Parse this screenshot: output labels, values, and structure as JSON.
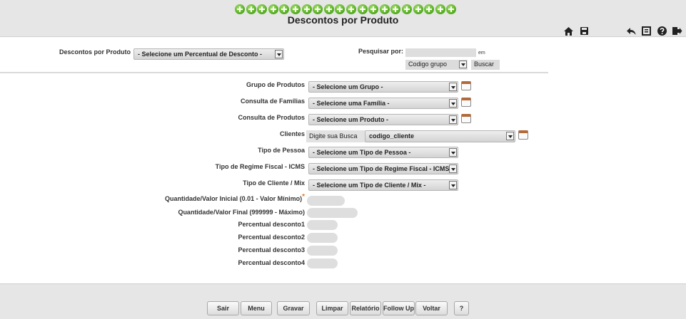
{
  "header": {
    "title": "Descontos por Produto",
    "plus_icon_count": 20,
    "icons": [
      "home-icon",
      "save-icon",
      "back-arrow-icon",
      "report-icon",
      "help-icon",
      "exit-icon"
    ]
  },
  "top_filter": {
    "label": "Descontos por Produto",
    "select_value": "- Selecione um Percentual de Desconto -",
    "search_label": "Pesquisar por:",
    "search_value": "",
    "em_label": "em",
    "search_field": "Codigo grupo",
    "search_button": "Buscar"
  },
  "form": {
    "grupo": {
      "label": "Grupo de Produtos",
      "value": "- Selecione um Grupo -"
    },
    "familias": {
      "label": "Consulta de Famílias",
      "value": "- Selecione uma Família -"
    },
    "produtos": {
      "label": "Consulta de Produtos",
      "value": "- Selecione um Produto -"
    },
    "clientes": {
      "label": "Clientes",
      "search_button": "Digite sua Busca",
      "value": "codigo_cliente"
    },
    "tipo_pessoa": {
      "label": "Tipo de Pessoa",
      "value": "- Selecione um Tipo de Pessoa -"
    },
    "regime": {
      "label": "Tipo de Regime Fiscal - ICMS",
      "value": "- Selecione um Tipo de Regime Fiscal - ICMS -"
    },
    "tipo_cliente": {
      "label": "Tipo de Cliente / Mix",
      "value": "- Selecione um Tipo de Cliente / Mix -"
    },
    "qtd_inicial": {
      "label": "Quantidade/Valor Inicial (0.01 - Valor Mínimo)",
      "required_mark": "*",
      "value": ""
    },
    "qtd_final": {
      "label": "Quantidade/Valor Final (999999 - Máximo)",
      "value": ""
    },
    "percentuais": [
      {
        "label": "Percentual desconto1",
        "value": ""
      },
      {
        "label": "Percentual desconto2",
        "value": ""
      },
      {
        "label": "Percentual desconto3",
        "value": ""
      },
      {
        "label": "Percentual desconto4",
        "value": ""
      }
    ]
  },
  "footer": {
    "buttons": [
      "Sair",
      "Menu",
      "Gravar",
      "Limpar",
      "Relatório",
      "Follow Up",
      "Voltar",
      "?"
    ]
  }
}
